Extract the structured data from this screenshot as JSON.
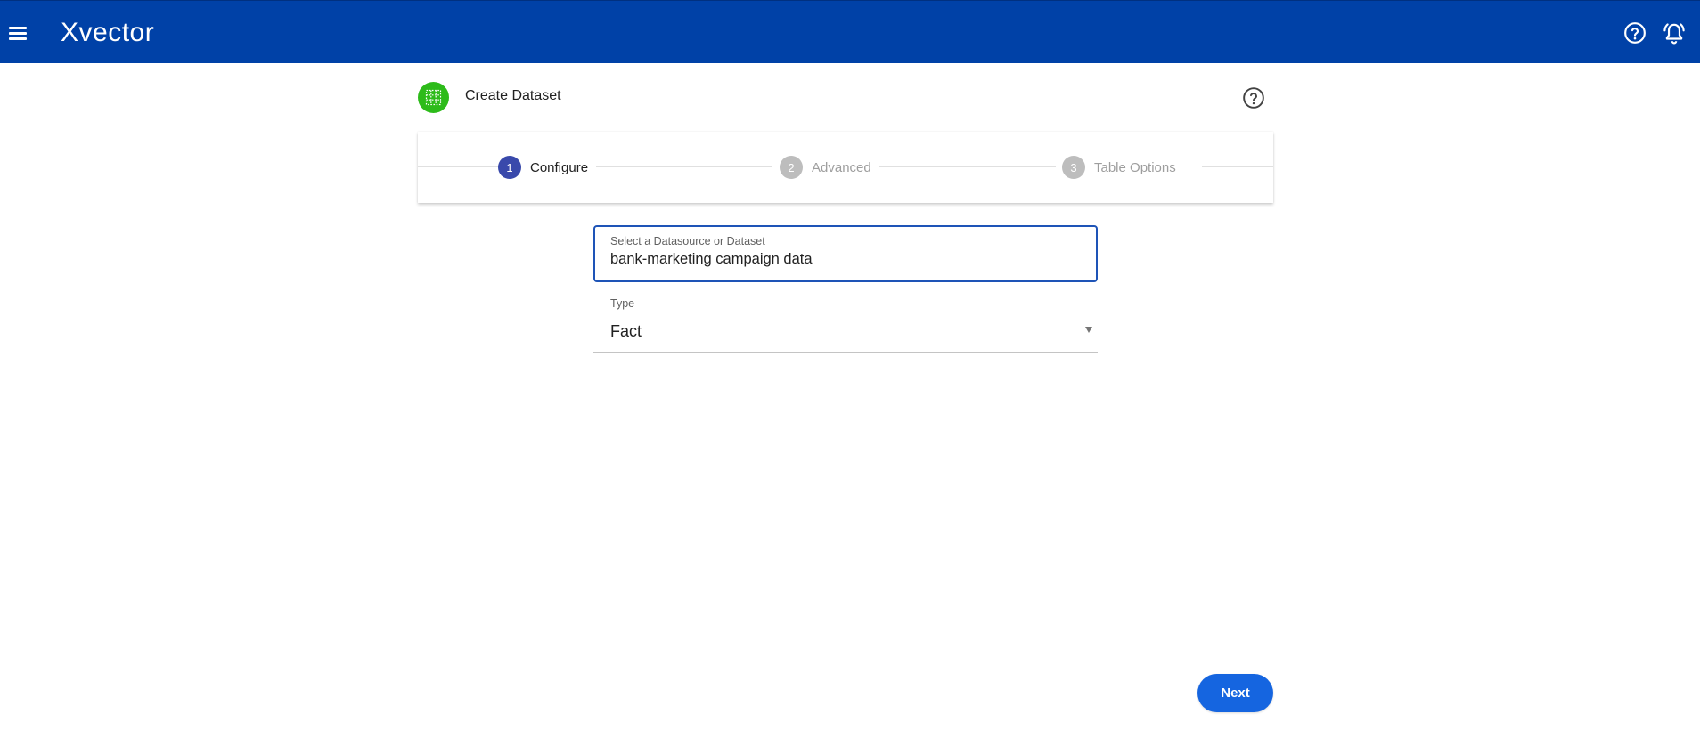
{
  "app": {
    "name": "Xvector"
  },
  "page": {
    "title": "Create Dataset"
  },
  "stepper": {
    "steps": [
      {
        "number": "1",
        "label": "Configure",
        "state": "active"
      },
      {
        "number": "2",
        "label": "Advanced",
        "state": "inactive"
      },
      {
        "number": "3",
        "label": "Table Options",
        "state": "inactive"
      }
    ]
  },
  "form": {
    "datasource": {
      "label": "Select a Datasource or Dataset",
      "value": "bank-marketing campaign data"
    },
    "type": {
      "label": "Type",
      "value": "Fact"
    }
  },
  "actions": {
    "next_label": "Next"
  },
  "icons": {
    "menu": "hamburger-menu-icon",
    "help": "help-circle-icon",
    "notifications": "bell-alert-icon",
    "dataset": "dataset-grid-icon"
  },
  "colors": {
    "appbar": "#0041a7",
    "primary_button": "#1565e0",
    "active_step": "#3949ab",
    "inactive_step": "#bdbdbd",
    "dataset_icon": "#2dbb1a",
    "focus_border": "#1e54b7"
  }
}
